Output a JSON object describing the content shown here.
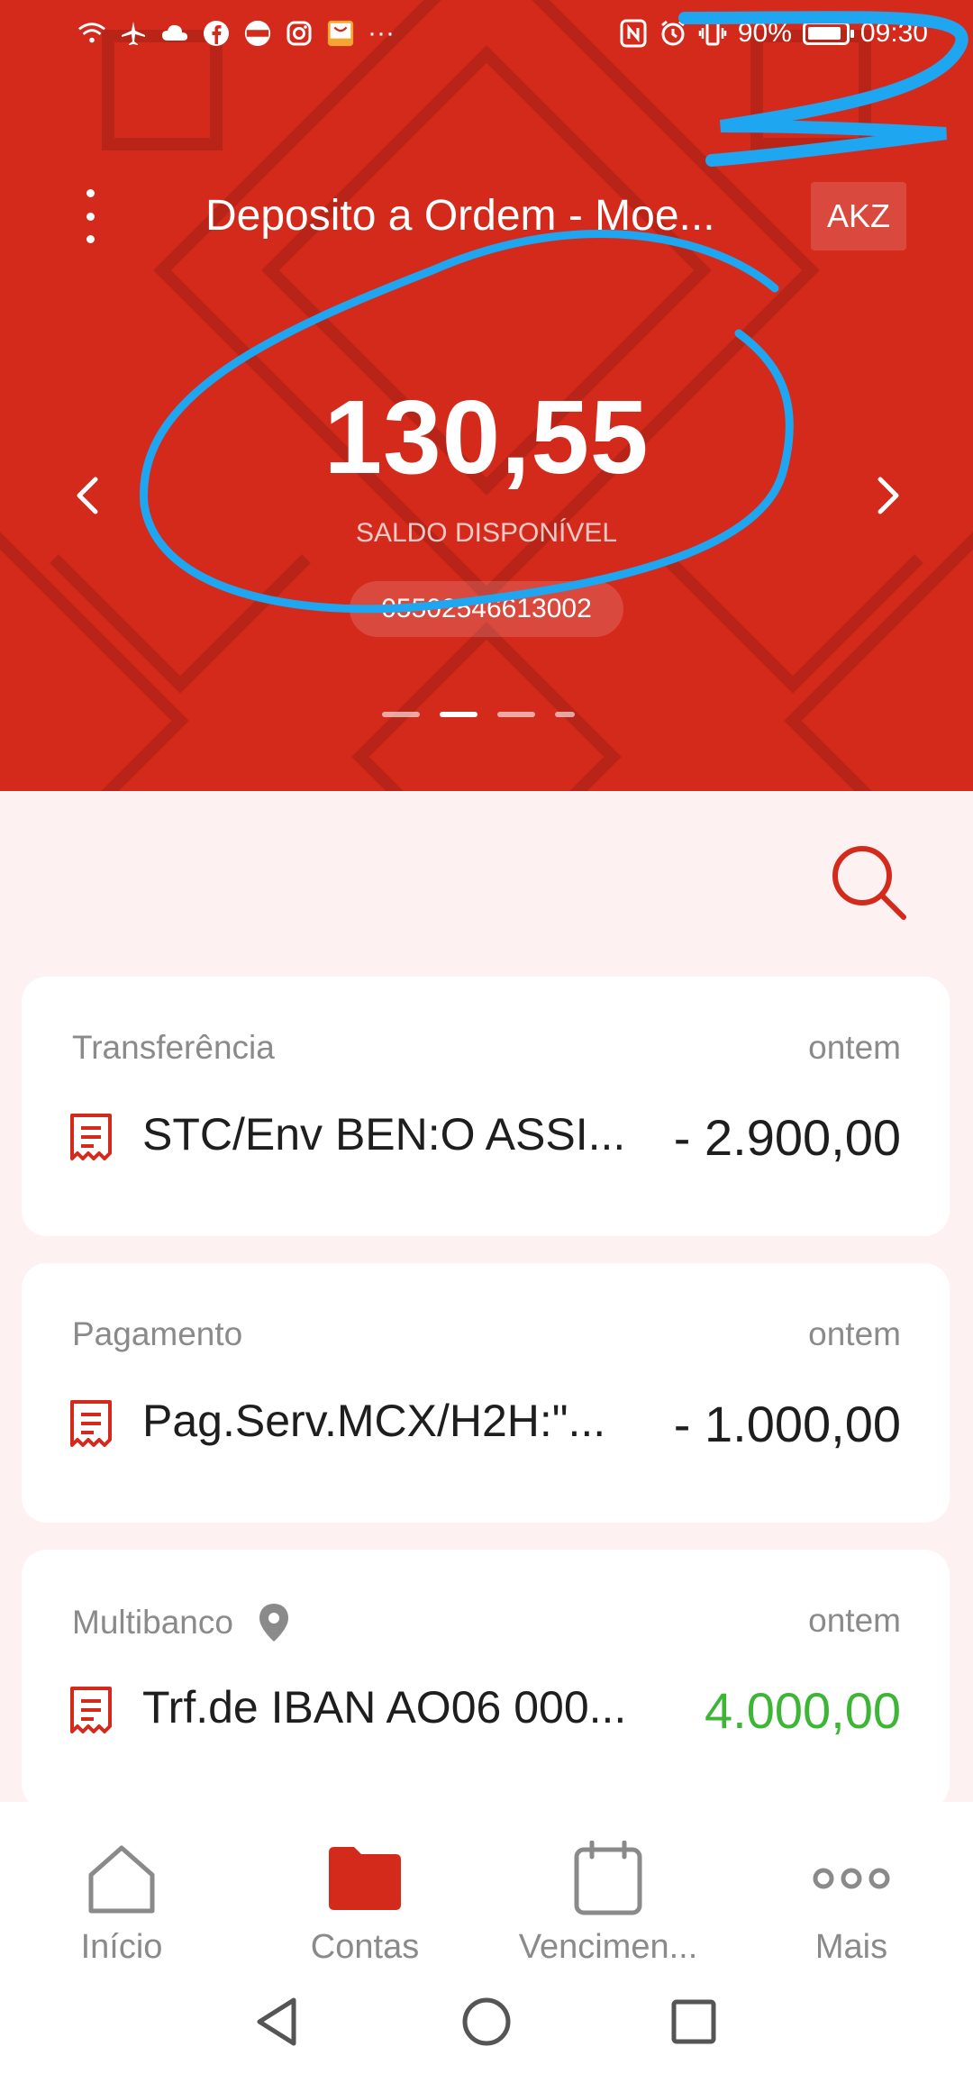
{
  "status_bar": {
    "battery": "90%",
    "battery_level": 0.9,
    "time": "09:30",
    "more": "···"
  },
  "account": {
    "title": "Deposito a Ordem - Moe...",
    "currency": "AKZ",
    "balance": "130,55",
    "balance_label": "SALDO DISPONÍVEL",
    "number": "05502546613002",
    "carousel_pages": 4,
    "carousel_active": 1
  },
  "transactions": [
    {
      "type": "Transferência",
      "date": "ontem",
      "description": "STC/Env BEN:O ASSI...",
      "amount": "- 2.900,00",
      "positive": false,
      "has_location": false
    },
    {
      "type": "Pagamento",
      "date": "ontem",
      "description": "Pag.Serv.MCX/H2H:\"...",
      "amount": "- 1.000,00",
      "positive": false,
      "has_location": false
    },
    {
      "type": "Multibanco",
      "date": "ontem",
      "description": "Trf.de IBAN AO06 000...",
      "amount": "4.000,00",
      "positive": true,
      "has_location": true
    }
  ],
  "nav": {
    "items": [
      {
        "label": "Início",
        "icon": "home-icon",
        "active": false
      },
      {
        "label": "Contas",
        "icon": "folder-icon",
        "active": true
      },
      {
        "label": "Vencimen...",
        "icon": "calendar-icon",
        "active": false
      },
      {
        "label": "Mais",
        "icon": "more-dots-icon",
        "active": false
      }
    ]
  },
  "colors": {
    "brand_red": "#d42a1c",
    "positive_green": "#3db535",
    "annotation_blue": "#1fa6f0"
  }
}
